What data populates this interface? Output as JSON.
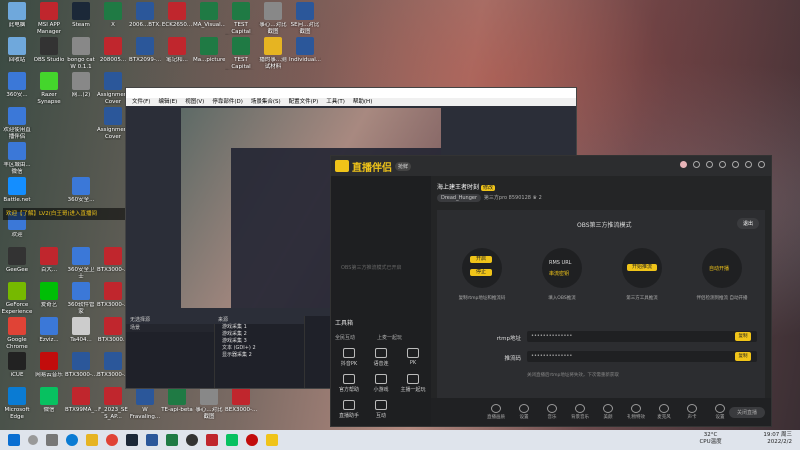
{
  "desktop_icons": [
    {
      "label": "此电脑",
      "col": 0,
      "row": 0,
      "color": "#6fa8dc"
    },
    {
      "label": "MSI APP Manager",
      "col": 1,
      "row": 0,
      "color": "#c0262d"
    },
    {
      "label": "Steam",
      "col": 2,
      "row": 0,
      "color": "#1b2838"
    },
    {
      "label": "X",
      "col": 3,
      "row": 0,
      "color": "#1f7a44"
    },
    {
      "label": "2006...BTX...Z_XTMD_L...",
      "col": 4,
      "row": 0,
      "color": "#2b579a"
    },
    {
      "label": "ECK2650...",
      "col": 5,
      "row": 0,
      "color": "#c0262d"
    },
    {
      "label": "MA_Visual...",
      "col": 6,
      "row": 0,
      "color": "#1f7a44"
    },
    {
      "label": "TEST Capital Budgeting...",
      "col": 7,
      "row": 0,
      "color": "#1f7a44"
    },
    {
      "label": "事心...对比截图",
      "col": 8,
      "row": 0,
      "color": "#888"
    },
    {
      "label": "SE问...对比截图",
      "col": 9,
      "row": 0,
      "color": "#2b579a"
    },
    {
      "label": "回收站",
      "col": 0,
      "row": 1,
      "color": "#6fa8dc"
    },
    {
      "label": "OBS Studio",
      "col": 1,
      "row": 1,
      "color": "#333"
    },
    {
      "label": "bongo cat W 0.1.1",
      "col": 2,
      "row": 1,
      "color": "#888"
    },
    {
      "label": "208005...",
      "col": 3,
      "row": 1,
      "color": "#c0262d"
    },
    {
      "label": "BTX2099-...Z_XTMD_L...",
      "col": 4,
      "row": 1,
      "color": "#2b579a"
    },
    {
      "label": "笔记和...",
      "col": 5,
      "row": 1,
      "color": "#c0262d"
    },
    {
      "label": "Ma...picture",
      "col": 6,
      "row": 1,
      "color": "#1f7a44"
    },
    {
      "label": "TEST Capital Budgeting...",
      "col": 7,
      "row": 1,
      "color": "#1f7a44"
    },
    {
      "label": "播的事...测试材料",
      "col": 8,
      "row": 1,
      "color": "#e6b422"
    },
    {
      "label": "Individual...reflection",
      "col": 9,
      "row": 1,
      "color": "#2b579a"
    },
    {
      "label": "360安...",
      "col": 0,
      "row": 2,
      "color": "#3b78d8"
    },
    {
      "label": "Razer Synapse",
      "col": 1,
      "row": 2,
      "color": "#44d62c"
    },
    {
      "label": "网...(2)",
      "col": 2,
      "row": 2,
      "color": "#888"
    },
    {
      "label": "Assignment Cover Sheet",
      "col": 3,
      "row": 2,
      "color": "#2b579a"
    },
    {
      "label": "欢迎使用直播伴侣",
      "col": 0,
      "row": 3,
      "color": "#3b78d8"
    },
    {
      "label": "Assignment Cover Sheet",
      "col": 3,
      "row": 3,
      "color": "#2b579a"
    },
    {
      "label": "丰区城由...微信",
      "col": 0,
      "row": 4,
      "color": "#3b78d8"
    },
    {
      "label": "Battle.net",
      "col": 0,
      "row": 5,
      "color": "#148eff"
    },
    {
      "label": "360安全...",
      "col": 2,
      "row": 5,
      "color": "#3b78d8"
    },
    {
      "label": "欢迎",
      "col": 0,
      "row": 6,
      "color": "#3b78d8"
    },
    {
      "label": "GeeGee",
      "col": 0,
      "row": 7,
      "color": "#333"
    },
    {
      "label": "百大...",
      "col": 1,
      "row": 7,
      "color": "#c0262d"
    },
    {
      "label": "360安全卫士",
      "col": 2,
      "row": 7,
      "color": "#3b78d8"
    },
    {
      "label": "BTX3000-...",
      "col": 3,
      "row": 7,
      "color": "#c0262d"
    },
    {
      "label": "GeForce Experience",
      "col": 0,
      "row": 8,
      "color": "#76b900"
    },
    {
      "label": "爱奇艺",
      "col": 1,
      "row": 8,
      "color": "#00be06"
    },
    {
      "label": "360软件管家",
      "col": 2,
      "row": 8,
      "color": "#3b78d8"
    },
    {
      "label": "BTX3000-...",
      "col": 3,
      "row": 8,
      "color": "#c0262d"
    },
    {
      "label": "Google Chrome",
      "col": 0,
      "row": 9,
      "color": "#e04336"
    },
    {
      "label": "Ezviz...",
      "col": 1,
      "row": 9,
      "color": "#3b78d8"
    },
    {
      "label": "Ta404...",
      "col": 2,
      "row": 9,
      "color": "#ccc"
    },
    {
      "label": "BTX3000...",
      "col": 3,
      "row": 9,
      "color": "#c0262d"
    },
    {
      "label": "iCUE",
      "col": 0,
      "row": 10,
      "color": "#222"
    },
    {
      "label": "网易云音乐",
      "col": 1,
      "row": 10,
      "color": "#c20c0c"
    },
    {
      "label": "BTX3000-...",
      "col": 2,
      "row": 10,
      "color": "#2b579a"
    },
    {
      "label": "BTX3000-...",
      "col": 3,
      "row": 10,
      "color": "#2b579a"
    },
    {
      "label": "Microsoft Edge",
      "col": 0,
      "row": 11,
      "color": "#0a7bd3"
    },
    {
      "label": "微信",
      "col": 1,
      "row": 11,
      "color": "#07c160"
    },
    {
      "label": "BTX99MA_...",
      "col": 2,
      "row": 11,
      "color": "#c0262d"
    },
    {
      "label": "F_2023_SE S_AP...",
      "col": 3,
      "row": 11,
      "color": "#c0262d"
    },
    {
      "label": "W Fravaling...",
      "col": 4,
      "row": 11,
      "color": "#2b579a"
    },
    {
      "label": "TE-api-beta",
      "col": 5,
      "row": 11,
      "color": "#1f7a44"
    },
    {
      "label": "事心...对比截图",
      "col": 6,
      "row": 11,
      "color": "#888"
    },
    {
      "label": "BEX3000-...",
      "col": 7,
      "row": 11,
      "color": "#c0262d"
    }
  ],
  "notification": {
    "text": "欢迎【了解】LV2(白王哥)进入直播间"
  },
  "obs": {
    "menu": [
      "文件(F)",
      "编辑(E)",
      "视图(V)",
      "停靠部件(D)",
      "场景集合(S)",
      "配置文件(P)",
      "工具(T)",
      "帮助(H)"
    ],
    "scenes_header": "场景",
    "sources_header": "来源",
    "sources": [
      "游戏采集 1",
      "游戏采集 2",
      "游戏采集 3",
      "文本 (GDI+) 2",
      "显示器采集 2"
    ],
    "source_label": "无选择源"
  },
  "zhibo": {
    "app_name": "直播伴侣",
    "version": "抢鲜",
    "stream_title": "海上建王者时刻",
    "title_tag": "修改",
    "streamer_pill": "Dread_Hunger",
    "meta": "第三方pro  8590128  ♛ 2",
    "sidebar": {
      "empty_hint": "OBS第三方推流模式已开启",
      "tool_header": "工具箱",
      "tabs": [
        "全民互动",
        "上麦一起玩"
      ],
      "tools": [
        "抖音PK",
        "语音连",
        "PK",
        "官方帮助",
        "小游戏",
        "主播一起玩",
        "直播助手",
        "互动"
      ]
    },
    "mode_title": "OBS第三方推流模式",
    "close_btn": "退出",
    "steps": [
      {
        "btn": "开启",
        "btn2": "停止",
        "text": "复制rtmp地址和推流码"
      },
      {
        "btn": "RMS URL",
        "btn2": "串流密钥",
        "text": "填入OBS推流"
      },
      {
        "btn": "开始推流",
        "text": "第三方工具推流"
      },
      {
        "btn": "自动开播",
        "text": "伴侣检测到推流 自动开播"
      }
    ],
    "rtmp_label": "rtmp地址",
    "rtmp_value": "••••••••••••••",
    "key_label": "推流码",
    "key_value": "••••••••••••••",
    "copy_label": "复制",
    "hint": "关闭直播后rtmp地址将失效，下次需重新获取",
    "bottom_tools": [
      "直播画质",
      "设置",
      "音乐",
      "背景音乐",
      "美颜",
      "礼物特效",
      "麦克风",
      "声卡",
      "设置"
    ],
    "start_button": "关闭直播"
  },
  "tray": {
    "temp": "32°C",
    "temp_label": "CPU温度",
    "time": "19:07",
    "date": "2022/2/2",
    "day": "周三"
  }
}
